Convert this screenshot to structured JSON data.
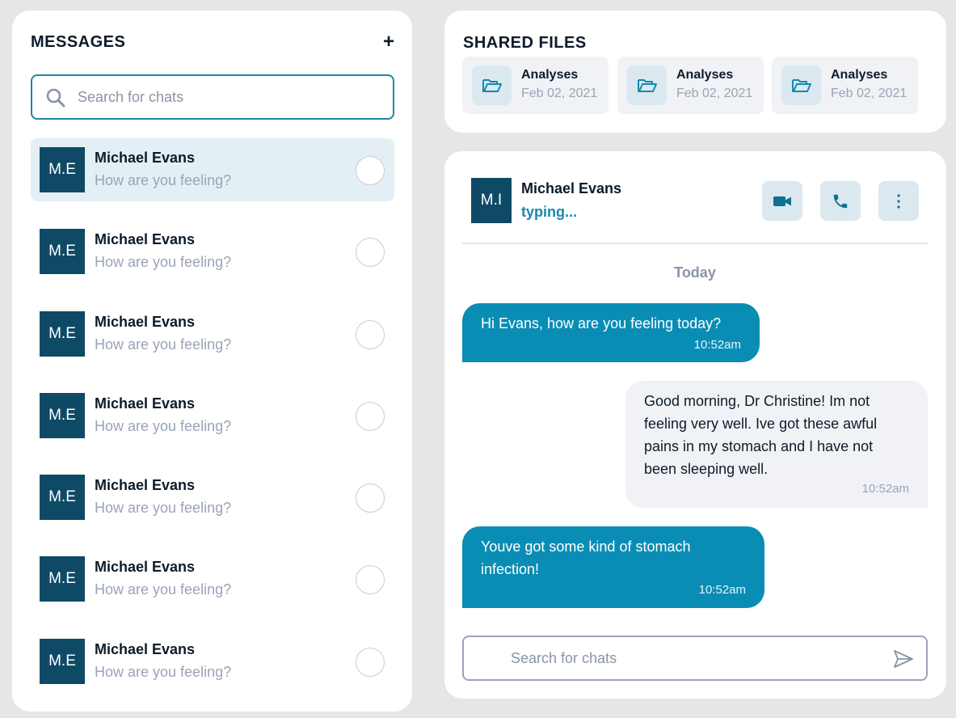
{
  "messages": {
    "title": "MESSAGES",
    "add_label": "+",
    "search_placeholder": "Search for chats",
    "chats": [
      {
        "initials": "M.E",
        "name": "Michael Evans",
        "preview": "How are you feeling?",
        "active": true
      },
      {
        "initials": "M.E",
        "name": "Michael Evans",
        "preview": "How are you feeling?",
        "active": false
      },
      {
        "initials": "M.E",
        "name": "Michael Evans",
        "preview": "How are you feeling?",
        "active": false
      },
      {
        "initials": "M.E",
        "name": "Michael Evans",
        "preview": "How are you feeling?",
        "active": false
      },
      {
        "initials": "M.E",
        "name": "Michael Evans",
        "preview": "How are you feeling?",
        "active": false
      },
      {
        "initials": "M.E",
        "name": "Michael Evans",
        "preview": "How are you feeling?",
        "active": false
      },
      {
        "initials": "M.E",
        "name": "Michael Evans",
        "preview": "How are you feeling?",
        "active": false
      }
    ]
  },
  "shared_files": {
    "title": "SHARED FILES",
    "files": [
      {
        "name": "Analyses",
        "date": "Feb 02, 2021",
        "icon": "folder-open-icon"
      },
      {
        "name": "Analyses",
        "date": "Feb 02, 2021",
        "icon": "folder-open-icon"
      },
      {
        "name": "Analyses",
        "date": "Feb 02, 2021",
        "icon": "folder-open-icon"
      }
    ]
  },
  "conversation": {
    "contact": {
      "initials": "M.I",
      "name": "Michael Evans",
      "status": "typing..."
    },
    "actions": [
      {
        "icon": "video-camera-icon"
      },
      {
        "icon": "phone-icon"
      },
      {
        "icon": "more-vertical-icon"
      }
    ],
    "day_label": "Today",
    "messages": [
      {
        "direction": "out",
        "text": "Hi Evans, how are you feeling today?",
        "time": "10:52am"
      },
      {
        "direction": "in",
        "lines": [
          "Good morning, Dr Christine! Im not",
          "feeling very well. Ive got these awful",
          "pains in my stomach and I have not",
          "been sleeping well."
        ],
        "time": "10:52am"
      },
      {
        "direction": "out",
        "lines": [
          "Youve got some kind of stomach",
          "infection!"
        ],
        "time": "10:52am"
      }
    ],
    "composer_placeholder": "Search for chats"
  },
  "colors": {
    "accent": "#0a8db5",
    "avatar_bg": "#0e4a66",
    "active_row_bg": "#e3eff4",
    "icon_tile_bg": "#dbe8ef",
    "muted_text": "#9aa3b8"
  }
}
